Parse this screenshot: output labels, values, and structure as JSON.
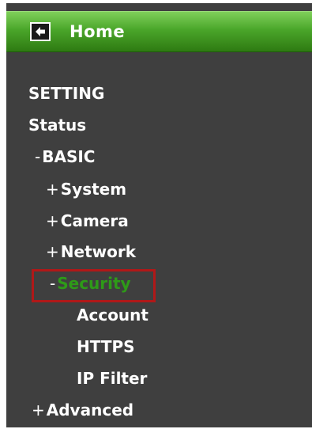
{
  "header": {
    "title": "Home",
    "back_icon": "arrow-left-icon"
  },
  "menu": {
    "setting": "SETTING",
    "status": "Status",
    "basic": {
      "prefix": "-",
      "label": "BASIC"
    },
    "system": {
      "prefix": "+",
      "label": "System"
    },
    "camera": {
      "prefix": "+",
      "label": "Camera"
    },
    "network": {
      "prefix": "+",
      "label": "Network"
    },
    "security": {
      "prefix": "-",
      "label": "Security"
    },
    "account": "Account",
    "https": "HTTPS",
    "ip_filter": "IP Filter",
    "advanced": {
      "prefix": "+",
      "label": "Advanced"
    }
  },
  "colors": {
    "panel_bg": "#3f3f3f",
    "header_green": "#4aa62a",
    "active_text": "#2e9a18",
    "highlight_border": "#b01818"
  }
}
